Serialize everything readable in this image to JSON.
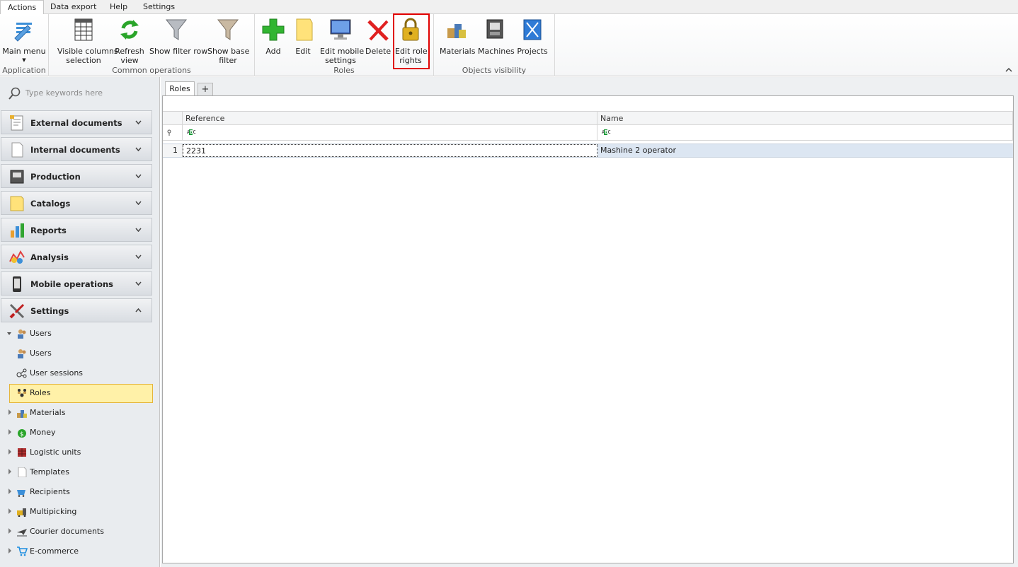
{
  "menu": {
    "tabs": [
      "Actions",
      "Data export",
      "Help",
      "Settings"
    ],
    "active": "Actions"
  },
  "ribbon": {
    "groups": {
      "application": "Application",
      "common": "Common operations",
      "roles": "Roles",
      "visibility": "Objects visibility"
    },
    "buttons": {
      "main_menu": "Main menu",
      "visible_columns_1": "Visible columns",
      "visible_columns_2": "selection",
      "refresh_1": "Refresh",
      "refresh_2": "view",
      "show_filter_row": "Show filter row",
      "show_base_filter_1": "Show base",
      "show_base_filter_2": "filter",
      "add": "Add",
      "edit": "Edit",
      "edit_mobile_1": "Edit mobile",
      "edit_mobile_2": "settings",
      "delete": "Delete",
      "edit_role_rights_1": "Edit role",
      "edit_role_rights_2": "rights",
      "materials": "Materials",
      "machines": "Machines",
      "projects": "Projects"
    }
  },
  "sidebar": {
    "search_placeholder": "Type keywords here",
    "sections": [
      {
        "label": "External documents",
        "icon": "document-icon"
      },
      {
        "label": "Internal documents",
        "icon": "blank-page-icon"
      },
      {
        "label": "Production",
        "icon": "machine-icon"
      },
      {
        "label": "Catalogs",
        "icon": "folder-icon"
      },
      {
        "label": "Reports",
        "icon": "bar-chart-icon"
      },
      {
        "label": "Analysis",
        "icon": "analysis-icon"
      },
      {
        "label": "Mobile operations",
        "icon": "mobile-icon"
      },
      {
        "label": "Settings",
        "icon": "tools-icon"
      }
    ],
    "tree": [
      {
        "label": "Users",
        "icon": "users-icon"
      },
      {
        "label": "Users",
        "icon": "users-icon"
      },
      {
        "label": "User sessions",
        "icon": "sessions-icon"
      },
      {
        "label": "Roles",
        "icon": "roles-icon"
      },
      {
        "label": "Materials",
        "icon": "materials-icon"
      },
      {
        "label": "Money",
        "icon": "money-icon"
      },
      {
        "label": "Logistic units",
        "icon": "logistic-icon"
      },
      {
        "label": "Templates",
        "icon": "template-icon"
      },
      {
        "label": "Recipients",
        "icon": "recipients-icon"
      },
      {
        "label": "Multipicking",
        "icon": "multipicking-icon"
      },
      {
        "label": "Courier documents",
        "icon": "plane-icon"
      },
      {
        "label": "E-commerce",
        "icon": "cart-icon"
      }
    ]
  },
  "content": {
    "tab": "Roles",
    "add_tab": "+",
    "columns": [
      "Reference",
      "Name"
    ],
    "rows": [
      {
        "num": "1",
        "reference": "2231",
        "name": "Mashine 2 operator"
      }
    ]
  },
  "colors": {
    "highlight": "#e00000",
    "selected_node": "#fff1a8",
    "selected_row": "#dce6f2"
  }
}
